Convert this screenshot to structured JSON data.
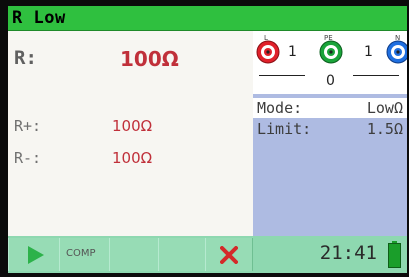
{
  "title": "R Low",
  "main": {
    "r_label": "R:",
    "r_value": "100Ω",
    "r_plus_label": "R+:",
    "r_plus_value": "100Ω",
    "r_minus_label": "R-:",
    "r_minus_value": "100Ω"
  },
  "terminals": [
    {
      "name": "L",
      "count": "1",
      "color": "#e0202a"
    },
    {
      "name": "PE",
      "count": "1",
      "color": "#1aa43a",
      "below": "0"
    },
    {
      "name": "N",
      "count": "1",
      "color": "#1f6fe0"
    }
  ],
  "settings": {
    "mode_label": "Mode:",
    "mode_value": "LowΩ",
    "limit_label": "Limit:",
    "limit_value": "1.5Ω"
  },
  "softkeys": {
    "comp_label": "COMP"
  },
  "status": {
    "time": "21:41",
    "battery_color": "#1a9e2a"
  },
  "colors": {
    "accent": "#2fc03f",
    "value_red": "#c0303a",
    "info_panel": "#aebbe2",
    "bottom_bar": "#8ed8b0"
  }
}
